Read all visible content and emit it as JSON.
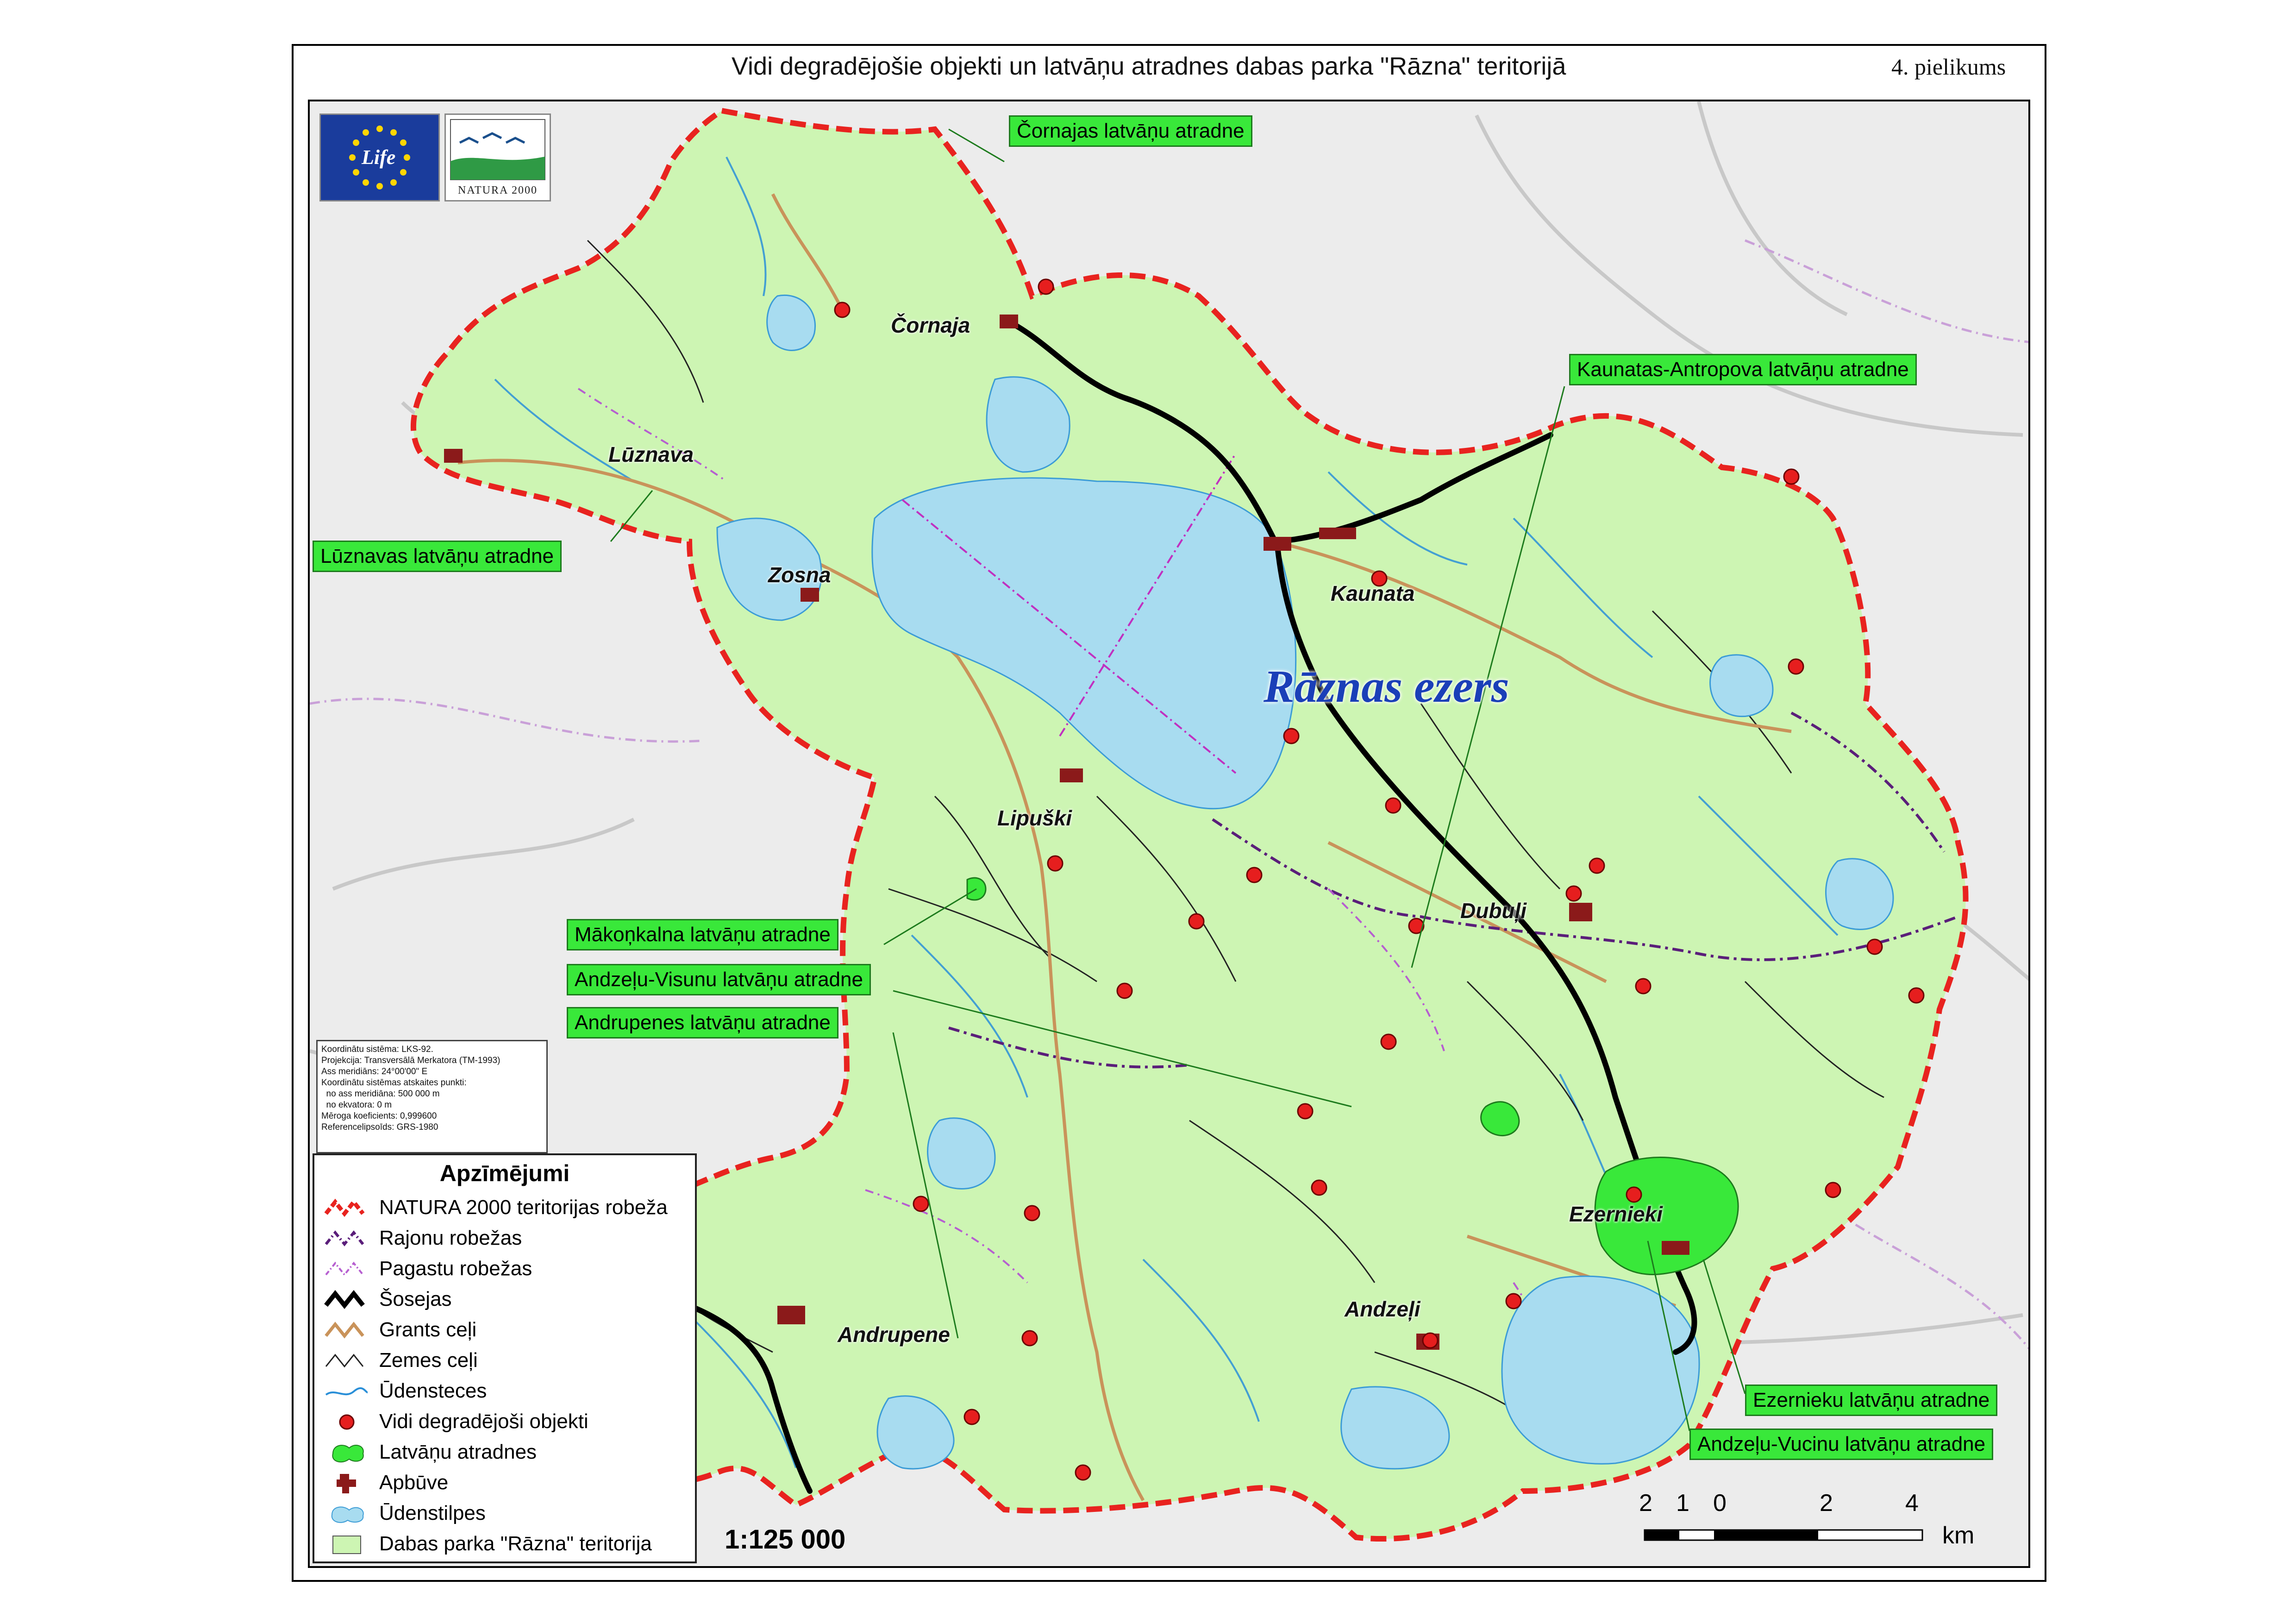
{
  "title": "Vidi degradējošie objekti un latvāņu atradnes dabas parka \"Rāzna\" teritorijā",
  "annex": "4. pielikums",
  "lake_label": "Rāznas ezers",
  "logos": {
    "eu_life": "Life",
    "natura": "NATURA 2000"
  },
  "places": [
    {
      "key": "cornaja",
      "name": "Čornaja"
    },
    {
      "key": "luznava",
      "name": "Lūznava"
    },
    {
      "key": "zosna",
      "name": "Zosna"
    },
    {
      "key": "kaunata",
      "name": "Kaunata"
    },
    {
      "key": "lipuski",
      "name": "Lipuški"
    },
    {
      "key": "dubuli",
      "name": "Dubuļi"
    },
    {
      "key": "ezernieki",
      "name": "Ezernieki"
    },
    {
      "key": "andzeli",
      "name": "Andzeļi"
    },
    {
      "key": "andrupene",
      "name": "Andrupene"
    }
  ],
  "callouts": [
    {
      "key": "cornajas",
      "text": "Čornajas latvāņu atradne"
    },
    {
      "key": "kaunatas",
      "text": "Kaunatas-Antropova latvāņu atradne"
    },
    {
      "key": "luznavas",
      "text": "Lūznavas latvāņu atradne"
    },
    {
      "key": "makonkalna",
      "text": "Mākoņkalna latvāņu atradne"
    },
    {
      "key": "andzelu_visunu",
      "text": "Andzeļu-Visunu latvāņu atradne"
    },
    {
      "key": "andrupenes",
      "text": "Andrupenes latvāņu atradne"
    },
    {
      "key": "ezernieku",
      "text": "Ezernieku latvāņu atradne"
    },
    {
      "key": "andzelu_vucinu",
      "text": "Andzeļu-Vucinu latvāņu atradne"
    }
  ],
  "coord_info": [
    "Koordinātu sistēma: LKS-92.",
    "Projekcija: Transversālā Merkatora (TM-1993)",
    "Ass meridiāns: 24°00'00\" E",
    "Koordinātu sistēmas atskaites punkti:",
    "  no ass meridiāna: 500 000 m",
    "  no ekvatora: 0 m",
    "Mēroga koeficients: 0,999600",
    "Referencelipsoīds: GRS-1980"
  ],
  "legend": {
    "title": "Apzīmējumi",
    "items": [
      {
        "label": "NATURA 2000 teritorijas robeža",
        "symbol": "natura-boundary"
      },
      {
        "label": "Rajonu robežas",
        "symbol": "district-boundary"
      },
      {
        "label": "Pagastu robežas",
        "symbol": "parish-boundary"
      },
      {
        "label": "Šosejas",
        "symbol": "highway"
      },
      {
        "label": "Grants ceļi",
        "symbol": "gravel-road"
      },
      {
        "label": "Zemes ceļi",
        "symbol": "dirt-road"
      },
      {
        "label": "Ūdensteces",
        "symbol": "watercourse"
      },
      {
        "label": "Vidi degradējoši objekti",
        "symbol": "degrading-object"
      },
      {
        "label": "Latvāņu atradnes",
        "symbol": "hogweed-site"
      },
      {
        "label": "Apbūve",
        "symbol": "buildup"
      },
      {
        "label": "Ūdenstilpes",
        "symbol": "waterbody"
      },
      {
        "label": "Dabas parka \"Rāzna\" teritorija",
        "symbol": "park-territory"
      }
    ]
  },
  "scale_text": "1:125 000",
  "scalebar": {
    "labels": [
      "2",
      "1",
      "0",
      "2",
      "4"
    ],
    "unit": "km"
  },
  "colors": {
    "park_fill": "#cdf5b3",
    "water": "#a8dcf0",
    "natura_boundary": "#e8231f",
    "hogweed": "#39e83a",
    "degrading_point": "#e61e1e",
    "buildup": "#8b1a1a",
    "background": "#ececec"
  }
}
